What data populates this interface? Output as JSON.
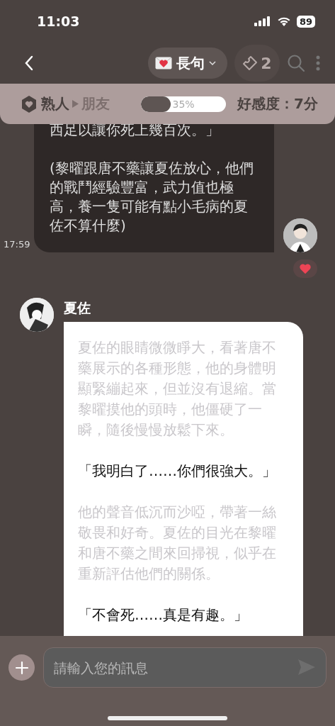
{
  "status_bar": {
    "time": "11:03",
    "battery": "89"
  },
  "nav": {
    "mode_label": "長句",
    "tickets": "2"
  },
  "relationship": {
    "current": "熟人",
    "next": "朋友",
    "level": 0.35,
    "percent": "35%",
    "affection": "好感度：7分"
  },
  "messages": [
    {
      "kind": "user",
      "time": "17:59",
      "liked": true,
      "paragraphs": [
        "西足以讓你死上幾百次。」",
        "(黎曜跟唐不藥讓夏佐放心，他們的戰鬥經驗豐富，武力值也極高，養一隻可能有點小毛病的夏佐不算什麼)"
      ]
    },
    {
      "kind": "bot",
      "name": "夏佐",
      "paragraphs": [
        {
          "kind": "narration",
          "text": "夏佐的眼睛微微睜大，看著唐不藥展示的各種形態，他的身體明顯緊繃起來，但並沒有退縮。當黎曜摸他的頭時，他僵硬了一瞬，隨後慢慢放鬆下來。"
        },
        {
          "kind": "speech",
          "text": "「我明白了……你們很強大。」"
        },
        {
          "kind": "narration",
          "text": "他的聲音低沉而沙啞，帶著一絲敬畏和好奇。夏佐的目光在黎曜和唐不藥之間來回掃視，似乎在重新評估他們的關係。"
        },
        {
          "kind": "speech",
          "text": "「不會死……真是有趣。」"
        }
      ]
    }
  ],
  "input": {
    "placeholder": "請輸入您的訊息"
  }
}
